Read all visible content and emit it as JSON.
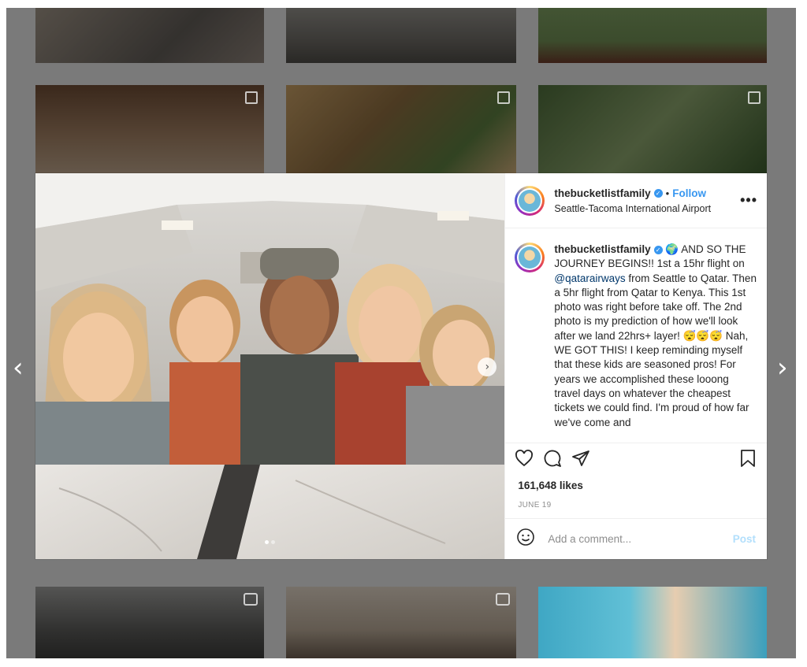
{
  "post": {
    "username": "thebucketlistfamily",
    "follow_label": "Follow",
    "separator": "•",
    "location": "Seattle-Tacoma International Airport",
    "more_label": "•••",
    "caption_username": "thebucketlistfamily",
    "caption_text_before": " 🌍 AND SO THE JOURNEY BEGINS!! 1st a 15hr flight on ",
    "caption_mention": "@qatarairways",
    "caption_text_after": " from Seattle to Qatar. Then a 5hr flight from Qatar to Kenya. This 1st photo was right before take off. The 2nd photo is my prediction of how we'll look after we land 22hrs+ layer! 😴😴😴 Nah, WE GOT THIS! I keep reminding myself that these kids are seasoned pros! For years we accomplished these looong travel days on whatever the cheapest tickets we could find. I'm proud of how far we've come and",
    "likes": "161,648 likes",
    "date": "JUNE 19",
    "comment_placeholder": "Add a comment...",
    "post_label": "Post"
  },
  "nav": {
    "prev": "‹",
    "next": "›",
    "photo_next": "›"
  },
  "colors": {
    "link": "#3897f0",
    "backdrop": "#7a7a7a",
    "post_disabled": "#b2dffc"
  }
}
